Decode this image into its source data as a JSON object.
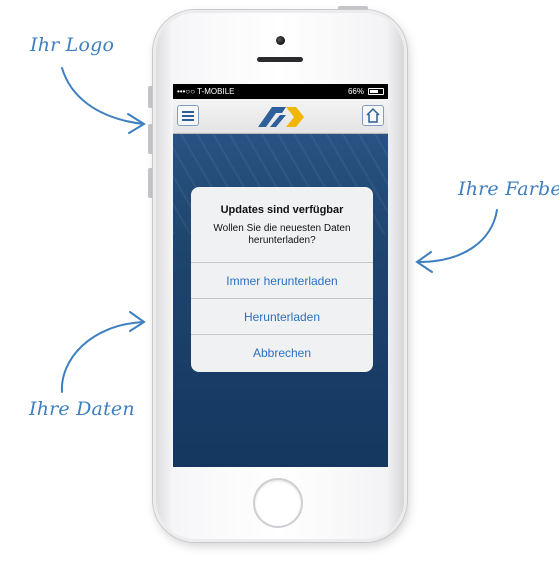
{
  "annotations": {
    "logo": "Ihr Logo",
    "colors": "Ihre Farben",
    "data": "Ihre Daten"
  },
  "status_bar": {
    "carrier": "•••○○ T-MOBILE",
    "battery_percent": "66%",
    "battery_level": 0.66
  },
  "nav_bar": {
    "menu_icon": "hamburger-menu-icon",
    "home_icon": "home-icon",
    "logo_colors": [
      "#2f5f9a",
      "#f2b705"
    ]
  },
  "alert": {
    "title": "Updates sind verfügbar",
    "message": "Wollen Sie die neuesten Daten herunterladen?",
    "buttons": [
      {
        "label": "Immer herunterladen"
      },
      {
        "label": "Herunterladen"
      },
      {
        "label": "Abbrechen"
      }
    ]
  },
  "colors": {
    "accent": "#2a72c2",
    "annotation": "#3f7fbf",
    "app_background": "#1d4676"
  }
}
